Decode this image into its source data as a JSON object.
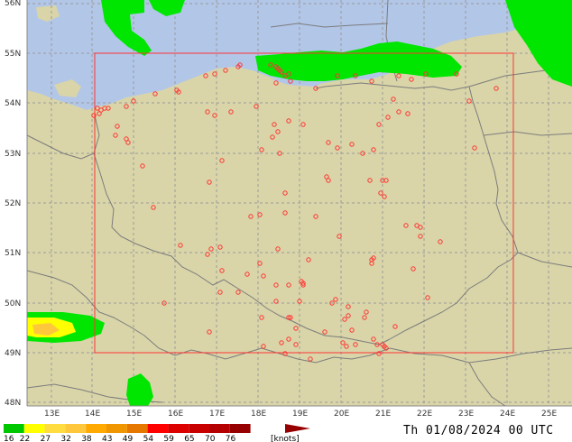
{
  "map": {
    "lon_ticks": [
      "13E",
      "14E",
      "15E",
      "16E",
      "17E",
      "18E",
      "19E",
      "20E",
      "21E",
      "22E",
      "23E",
      "24E",
      "25E"
    ],
    "lat_ticks": [
      "55N",
      "54N",
      "53N",
      "52N",
      "51N",
      "50N",
      "49N",
      "48N"
    ],
    "top_lat_label": "56N",
    "colors": {
      "land": "#d9d5a8",
      "sea": "#b2c6e8",
      "grid": "#9a9a9a",
      "border": "#808080",
      "box": "#ff3333",
      "station": "#ff3333"
    }
  },
  "legend": {
    "values": [
      "16",
      "22",
      "27",
      "32",
      "38",
      "43",
      "49",
      "54",
      "59",
      "65",
      "70",
      "76"
    ],
    "unit": "[knots]",
    "colors": [
      "#00c800",
      "#ffff00",
      "#ffdc40",
      "#ffc83c",
      "#ffaa00",
      "#f09600",
      "#e67800",
      "#ff0000",
      "#dc0000",
      "#c80000",
      "#b40000",
      "#960000"
    ]
  },
  "timestamp": "Th 01/08/2024 00 UTC"
}
